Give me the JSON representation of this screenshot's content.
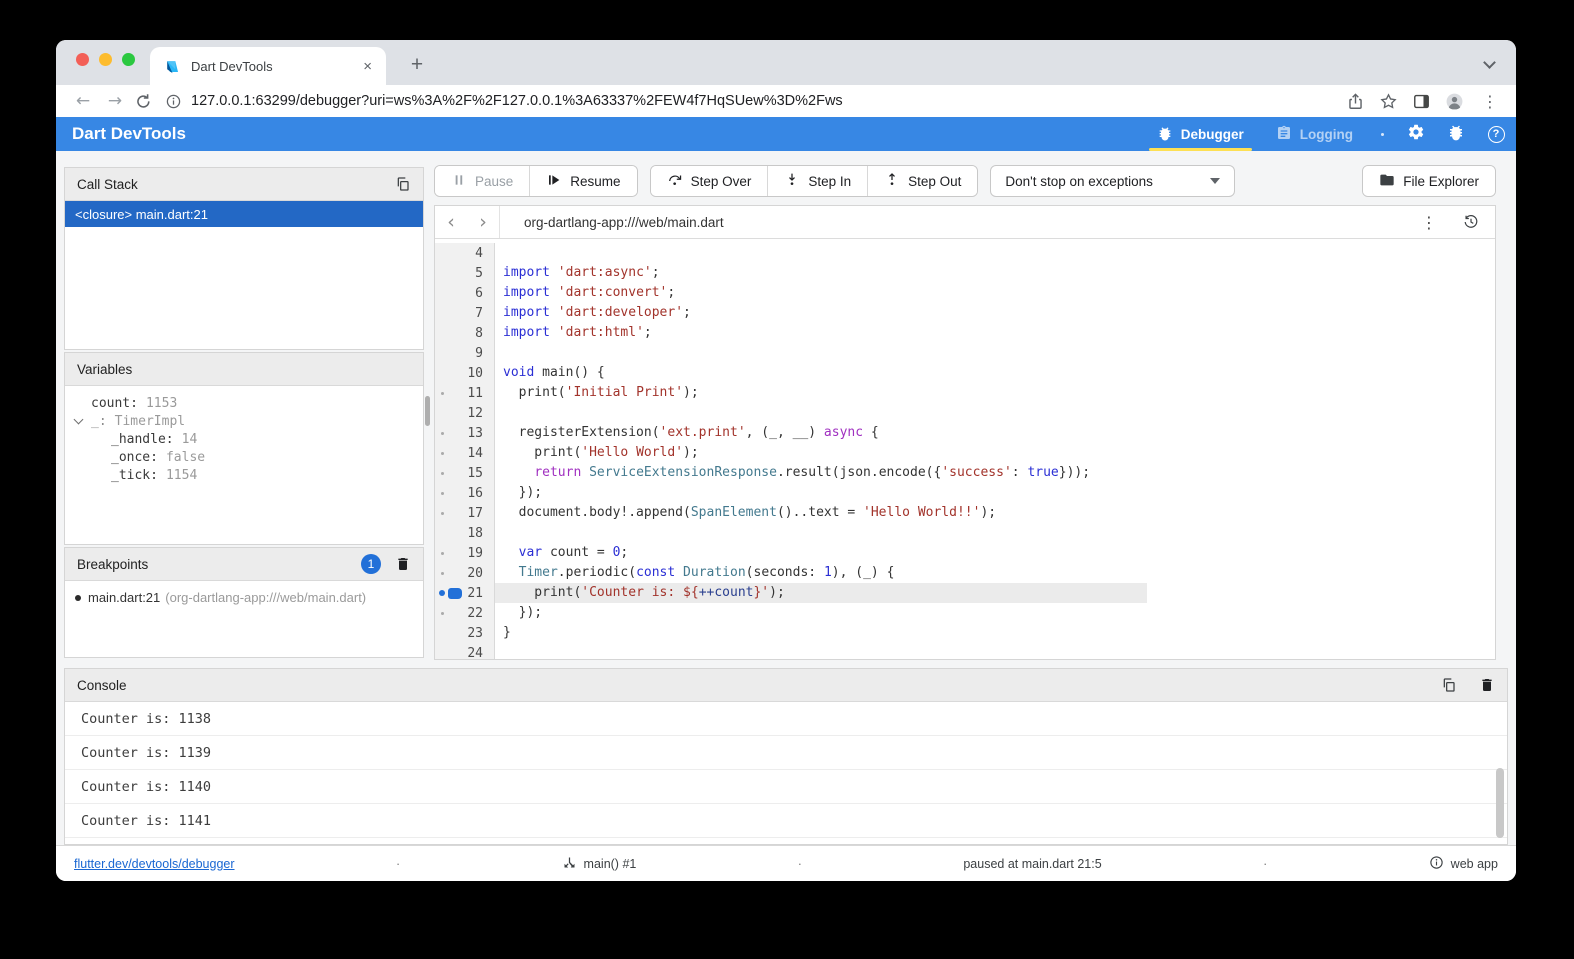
{
  "colors": {
    "appbar_blue": "#3787e4",
    "accent_blue": "#2270d8",
    "selected_row_blue": "#2368c5",
    "tab_underline_yellow": "#fde054",
    "keyword": "#2b2fd4",
    "string": "#a2332b",
    "type": "#43798e",
    "modifier": "#a030c0",
    "line_highlight": "#ebebeb"
  },
  "icons": {
    "back": "←",
    "forward": "→",
    "close_tab": "×",
    "new_tab": "+",
    "more_vertical": "⋮",
    "chevron_left": "‹",
    "chevron_right": "›",
    "question": "?",
    "dot": "·",
    "bullet": "●"
  },
  "browser": {
    "tab_title": "Dart DevTools",
    "url": "127.0.0.1:63299/debugger?uri=ws%3A%2F%2F127.0.0.1%3A63337%2FEW4f7HqSUew%3D%2Fws"
  },
  "app_bar": {
    "title": "Dart DevTools",
    "tabs": [
      {
        "label": "Debugger",
        "selected": true
      },
      {
        "label": "Logging",
        "selected": false
      }
    ]
  },
  "toolbar": {
    "pause_label": "Pause",
    "resume_label": "Resume",
    "step_over_label": "Step Over",
    "step_in_label": "Step In",
    "step_out_label": "Step Out",
    "exceptions_value": "Don't stop on exceptions",
    "file_explorer_label": "File Explorer"
  },
  "call_stack": {
    "title": "Call Stack",
    "frames": [
      {
        "label": "<closure> main.dart:21",
        "selected": true
      }
    ]
  },
  "variables": {
    "title": "Variables",
    "items": [
      {
        "indent": 0,
        "expander": false,
        "muted_name": false,
        "name": "count:",
        "value": "1153"
      },
      {
        "indent": 0,
        "expander": true,
        "muted_name": true,
        "name": "_:",
        "value": "TimerImpl"
      },
      {
        "indent": 1,
        "expander": false,
        "muted_name": false,
        "name": "_handle:",
        "value": "14"
      },
      {
        "indent": 1,
        "expander": false,
        "muted_name": false,
        "name": "_once:",
        "value": "false"
      },
      {
        "indent": 1,
        "expander": false,
        "muted_name": false,
        "name": "_tick:",
        "value": "1154"
      }
    ]
  },
  "breakpoints": {
    "title": "Breakpoints",
    "count": "1",
    "items": [
      {
        "main": "main.dart:21",
        "path": "(org-dartlang-app:///web/main.dart)"
      }
    ]
  },
  "editor": {
    "file": "org-dartlang-app:///web/main.dart",
    "paused_location": "21:5",
    "lines": [
      {
        "no": 4,
        "g": "",
        "tokens": []
      },
      {
        "no": 5,
        "g": "",
        "tokens": [
          [
            "k",
            "import"
          ],
          [
            "d",
            " "
          ],
          [
            "s",
            "'dart:async'"
          ],
          [
            "d",
            ";"
          ]
        ]
      },
      {
        "no": 6,
        "g": "",
        "tokens": [
          [
            "k",
            "import"
          ],
          [
            "d",
            " "
          ],
          [
            "s",
            "'dart:convert'"
          ],
          [
            "d",
            ";"
          ]
        ]
      },
      {
        "no": 7,
        "g": "",
        "tokens": [
          [
            "k",
            "import"
          ],
          [
            "d",
            " "
          ],
          [
            "s",
            "'dart:developer'"
          ],
          [
            "d",
            ";"
          ]
        ]
      },
      {
        "no": 8,
        "g": "",
        "tokens": [
          [
            "k",
            "import"
          ],
          [
            "d",
            " "
          ],
          [
            "s",
            "'dart:html'"
          ],
          [
            "d",
            ";"
          ]
        ]
      },
      {
        "no": 9,
        "g": "",
        "tokens": []
      },
      {
        "no": 10,
        "g": "",
        "tokens": [
          [
            "k",
            "void"
          ],
          [
            "d",
            " main() {"
          ]
        ]
      },
      {
        "no": 11,
        "g": "dot",
        "tokens": [
          [
            "d",
            "  print("
          ],
          [
            "s",
            "'Initial Print'"
          ],
          [
            "d",
            ");"
          ]
        ]
      },
      {
        "no": 12,
        "g": "",
        "tokens": []
      },
      {
        "no": 13,
        "g": "dot",
        "tokens": [
          [
            "d",
            "  registerExtension("
          ],
          [
            "s",
            "'ext.print'"
          ],
          [
            "d",
            ", (_, __) "
          ],
          [
            "p",
            "async"
          ],
          [
            "d",
            " {"
          ]
        ]
      },
      {
        "no": 14,
        "g": "dot",
        "tokens": [
          [
            "d",
            "    print("
          ],
          [
            "s",
            "'Hello World'"
          ],
          [
            "d",
            ");"
          ]
        ]
      },
      {
        "no": 15,
        "g": "dot",
        "tokens": [
          [
            "d",
            "    "
          ],
          [
            "p",
            "return"
          ],
          [
            "d",
            " "
          ],
          [
            "t",
            "ServiceExtensionResponse"
          ],
          [
            "d",
            ".result(json.encode({"
          ],
          [
            "s",
            "'success'"
          ],
          [
            "d",
            ": "
          ],
          [
            "k",
            "true"
          ],
          [
            "d",
            "}));"
          ]
        ]
      },
      {
        "no": 16,
        "g": "dot",
        "tokens": [
          [
            "d",
            "  });"
          ]
        ]
      },
      {
        "no": 17,
        "g": "dot",
        "tokens": [
          [
            "d",
            "  document.body!.append("
          ],
          [
            "t",
            "SpanElement"
          ],
          [
            "d",
            "()..text = "
          ],
          [
            "s",
            "'Hello World!!'"
          ],
          [
            "d",
            ");"
          ]
        ]
      },
      {
        "no": 18,
        "g": "",
        "tokens": []
      },
      {
        "no": 19,
        "g": "dot",
        "tokens": [
          [
            "d",
            "  "
          ],
          [
            "k",
            "var"
          ],
          [
            "d",
            " count = "
          ],
          [
            "k",
            "0"
          ],
          [
            "d",
            ";"
          ]
        ]
      },
      {
        "no": 20,
        "g": "dot",
        "tokens": [
          [
            "d",
            "  "
          ],
          [
            "t",
            "Timer"
          ],
          [
            "d",
            ".periodic("
          ],
          [
            "k",
            "const"
          ],
          [
            "d",
            " "
          ],
          [
            "t",
            "Duration"
          ],
          [
            "d",
            "(seconds: "
          ],
          [
            "k",
            "1"
          ],
          [
            "d",
            "), (_) {"
          ]
        ]
      },
      {
        "no": 21,
        "g": "bp",
        "hl": true,
        "caret": true,
        "tokens": [
          [
            "d",
            "    print("
          ],
          [
            "s",
            "'Counter is: ${"
          ],
          [
            "v",
            "++count"
          ],
          [
            "s",
            "}'"
          ],
          [
            "d",
            ");"
          ]
        ]
      },
      {
        "no": 22,
        "g": "dot",
        "tokens": [
          [
            "d",
            "  });"
          ]
        ]
      },
      {
        "no": 23,
        "g": "",
        "tokens": [
          [
            "d",
            "}"
          ]
        ]
      },
      {
        "no": 24,
        "g": "",
        "tokens": []
      }
    ]
  },
  "console": {
    "title": "Console",
    "lines": [
      "Counter is: 1138",
      "Counter is: 1139",
      "Counter is: 1140",
      "Counter is: 1141"
    ]
  },
  "footer": {
    "link": "flutter.dev/devtools/debugger",
    "isolate": "main() #1",
    "status": "paused at main.dart 21:5",
    "app_type": "web app"
  }
}
